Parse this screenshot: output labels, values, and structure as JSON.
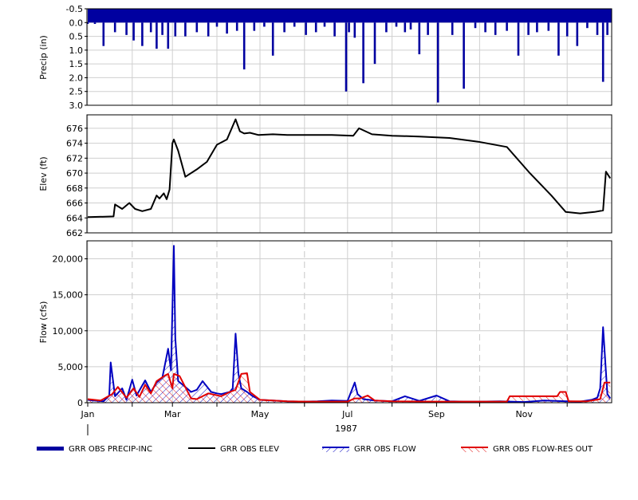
{
  "chart_data": [
    {
      "type": "bar",
      "ylabel": "Precip (in)",
      "ylim": [
        -0.5,
        3.0
      ],
      "inverted": true,
      "yticks": [
        "-0.5",
        "0.0",
        "0.5",
        "1.0",
        "1.5",
        "2.0",
        "2.5",
        "3.0"
      ],
      "yticks_values": [
        -0.5,
        0.0,
        0.5,
        1.0,
        1.5,
        2.0,
        2.5,
        3.0
      ],
      "series": [
        {
          "name": "GRR OBS PRECIP-INC",
          "color": "#0000a0",
          "x": [
            "1987-01-01",
            "1987-01-06",
            "1987-01-12",
            "1987-01-20",
            "1987-01-28",
            "1987-02-02",
            "1987-02-08",
            "1987-02-14",
            "1987-02-18",
            "1987-02-22",
            "1987-02-26",
            "1987-03-03",
            "1987-03-10",
            "1987-03-18",
            "1987-03-26",
            "1987-04-01",
            "1987-04-08",
            "1987-04-15",
            "1987-04-20",
            "1987-04-27",
            "1987-05-04",
            "1987-05-10",
            "1987-05-18",
            "1987-05-25",
            "1987-06-02",
            "1987-06-09",
            "1987-06-15",
            "1987-06-22",
            "1987-06-30",
            "1987-07-02",
            "1987-07-06",
            "1987-07-12",
            "1987-07-20",
            "1987-07-28",
            "1987-08-04",
            "1987-08-10",
            "1987-08-14",
            "1987-08-20",
            "1987-08-26",
            "1987-09-02",
            "1987-09-12",
            "1987-09-20",
            "1987-09-28",
            "1987-10-05",
            "1987-10-12",
            "1987-10-20",
            "1987-10-28",
            "1987-11-04",
            "1987-11-10",
            "1987-11-18",
            "1987-11-25",
            "1987-12-01",
            "1987-12-08",
            "1987-12-15",
            "1987-12-22",
            "1987-12-26",
            "1987-12-29"
          ],
          "values": [
            0.05,
            0.05,
            0.85,
            0.35,
            0.45,
            0.65,
            0.85,
            0.35,
            0.95,
            0.45,
            0.95,
            0.5,
            0.5,
            0.35,
            0.5,
            0.15,
            0.4,
            0.3,
            1.7,
            0.3,
            0.15,
            1.2,
            0.35,
            0.15,
            0.45,
            0.35,
            0.15,
            0.5,
            2.5,
            0.35,
            0.55,
            2.2,
            1.5,
            0.35,
            0.15,
            0.35,
            0.25,
            1.15,
            0.45,
            2.9,
            0.45,
            2.4,
            0.2,
            0.35,
            0.45,
            0.3,
            1.2,
            0.45,
            0.35,
            0.3,
            1.2,
            0.5,
            0.85,
            0.2,
            0.45,
            2.15,
            0.45
          ]
        }
      ]
    },
    {
      "type": "line",
      "ylabel": "Elev (ft)",
      "ylim": [
        662,
        677.8
      ],
      "yticks": [
        "676",
        "674",
        "672",
        "670",
        "668",
        "666",
        "664",
        "662"
      ],
      "yticks_values": [
        676,
        674,
        672,
        670,
        668,
        666,
        664,
        662
      ],
      "series": [
        {
          "name": "GRR OBS ELEV",
          "color": "#000000",
          "x": [
            "1987-01-01",
            "1987-01-19",
            "1987-01-20",
            "1987-01-25",
            "1987-01-30",
            "1987-02-03",
            "1987-02-08",
            "1987-02-14",
            "1987-02-18",
            "1987-02-20",
            "1987-02-23",
            "1987-02-25",
            "1987-02-27",
            "1987-03-01",
            "1987-03-02",
            "1987-03-05",
            "1987-03-10",
            "1987-03-18",
            "1987-03-25",
            "1987-04-01",
            "1987-04-08",
            "1987-04-14",
            "1987-04-17",
            "1987-04-20",
            "1987-04-24",
            "1987-04-30",
            "1987-05-10",
            "1987-05-20",
            "1987-06-01",
            "1987-06-20",
            "1987-07-05",
            "1987-07-09",
            "1987-07-18",
            "1987-08-01",
            "1987-08-20",
            "1987-09-10",
            "1987-09-30",
            "1987-10-20",
            "1987-11-05",
            "1987-11-20",
            "1987-11-30",
            "1987-12-10",
            "1987-12-20",
            "1987-12-26",
            "1987-12-28",
            "1987-12-31"
          ],
          "values": [
            664.1,
            664.2,
            665.8,
            665.2,
            666.0,
            665.2,
            664.9,
            665.2,
            667.0,
            666.6,
            667.3,
            666.5,
            667.8,
            674.0,
            674.5,
            673.0,
            669.5,
            670.5,
            671.5,
            673.8,
            674.5,
            677.2,
            675.6,
            675.3,
            675.4,
            675.1,
            675.2,
            675.1,
            675.1,
            675.1,
            675.0,
            676.0,
            675.2,
            675.0,
            674.9,
            674.7,
            674.2,
            673.5,
            670.0,
            667.0,
            664.8,
            664.6,
            664.8,
            665.0,
            670.2,
            669.3
          ]
        }
      ]
    },
    {
      "type": "line",
      "ylabel": "Flow (cfs)",
      "xlabel": "1987",
      "ylim": [
        0,
        22500
      ],
      "yticks": [
        "0",
        "5,000",
        "10,000",
        "15,000",
        "20,000"
      ],
      "yticks_values": [
        0,
        5000,
        10000,
        15000,
        20000
      ],
      "xticks": [
        "Jan",
        "Mar",
        "May",
        "Jul",
        "Sep",
        "Nov"
      ],
      "xticks_dates": [
        "1987-01-01",
        "1987-03-01",
        "1987-05-01",
        "1987-07-01",
        "1987-09-01",
        "1987-11-01"
      ],
      "series": [
        {
          "name": "GRR OBS FLOW",
          "color": "#0000c0",
          "hatched": true,
          "x": [
            "1987-01-01",
            "1987-01-05",
            "1987-01-12",
            "1987-01-16",
            "1987-01-17",
            "1987-01-20",
            "1987-01-25",
            "1987-01-28",
            "1987-02-01",
            "1987-02-04",
            "1987-02-10",
            "1987-02-14",
            "1987-02-18",
            "1987-02-22",
            "1987-02-26",
            "1987-02-28",
            "1987-03-02",
            "1987-03-03",
            "1987-03-05",
            "1987-03-10",
            "1987-03-14",
            "1987-03-18",
            "1987-03-22",
            "1987-03-28",
            "1987-04-01",
            "1987-04-04",
            "1987-04-10",
            "1987-04-12",
            "1987-04-14",
            "1987-04-16",
            "1987-04-18",
            "1987-04-22",
            "1987-04-26",
            "1987-05-01",
            "1987-05-10",
            "1987-05-20",
            "1987-06-01",
            "1987-06-10",
            "1987-06-20",
            "1987-07-01",
            "1987-07-06",
            "1987-07-08",
            "1987-07-12",
            "1987-07-20",
            "1987-08-01",
            "1987-08-10",
            "1987-08-20",
            "1987-09-01",
            "1987-09-10",
            "1987-09-20",
            "1987-10-01",
            "1987-10-15",
            "1987-11-01",
            "1987-11-15",
            "1987-12-01",
            "1987-12-10",
            "1987-12-18",
            "1987-12-22",
            "1987-12-24",
            "1987-12-26",
            "1987-12-29",
            "1987-12-31"
          ],
          "values": [
            400,
            300,
            200,
            1000,
            5600,
            900,
            2000,
            400,
            3200,
            1000,
            3100,
            1500,
            2800,
            3500,
            7500,
            4500,
            21800,
            9000,
            3000,
            2200,
            1500,
            1800,
            3000,
            1500,
            1300,
            1200,
            1500,
            2000,
            9600,
            4000,
            2000,
            1500,
            900,
            400,
            300,
            200,
            150,
            200,
            300,
            250,
            2800,
            1200,
            500,
            300,
            200,
            900,
            250,
            1000,
            200,
            150,
            150,
            200,
            100,
            300,
            200,
            150,
            400,
            700,
            2000,
            10500,
            1200,
            600
          ]
        },
        {
          "name": "GRR OBS FLOW-RES OUT",
          "color": "#e00000",
          "hatched": true,
          "x": [
            "1987-01-01",
            "1987-01-10",
            "1987-01-18",
            "1987-01-22",
            "1987-01-28",
            "1987-02-02",
            "1987-02-06",
            "1987-02-10",
            "1987-02-14",
            "1987-02-18",
            "1987-02-24",
            "1987-02-26",
            "1987-03-01",
            "1987-03-02",
            "1987-03-06",
            "1987-03-14",
            "1987-03-18",
            "1987-03-26",
            "1987-04-04",
            "1987-04-10",
            "1987-04-14",
            "1987-04-18",
            "1987-04-22",
            "1987-04-24",
            "1987-05-01",
            "1987-05-10",
            "1987-05-20",
            "1987-06-01",
            "1987-06-20",
            "1987-07-01",
            "1987-07-06",
            "1987-07-10",
            "1987-07-15",
            "1987-07-20",
            "1987-08-01",
            "1987-09-01",
            "1987-10-01",
            "1987-10-20",
            "1987-10-22",
            "1987-11-24",
            "1987-11-26",
            "1987-11-30",
            "1987-12-02",
            "1987-12-15",
            "1987-12-24",
            "1987-12-27",
            "1987-12-31"
          ],
          "values": [
            500,
            300,
            1200,
            2200,
            700,
            2000,
            800,
            2500,
            1300,
            3000,
            3800,
            4000,
            2000,
            4000,
            3700,
            600,
            500,
            1300,
            900,
            1500,
            1800,
            4000,
            4100,
            1500,
            400,
            300,
            200,
            150,
            150,
            150,
            600,
            600,
            1000,
            300,
            200,
            150,
            150,
            150,
            900,
            900,
            1500,
            1500,
            200,
            200,
            500,
            2800,
            2800
          ]
        }
      ]
    }
  ],
  "legend": [
    {
      "label": "GRR OBS PRECIP-INC",
      "color": "#0000a0",
      "style": "bar"
    },
    {
      "label": "GRR OBS ELEV",
      "color": "#000000",
      "style": "line"
    },
    {
      "label": "GRR OBS FLOW",
      "color": "#0000c0",
      "style": "hatch"
    },
    {
      "label": "GRR OBS FLOW-RES OUT",
      "color": "#e00000",
      "style": "hatch"
    }
  ]
}
